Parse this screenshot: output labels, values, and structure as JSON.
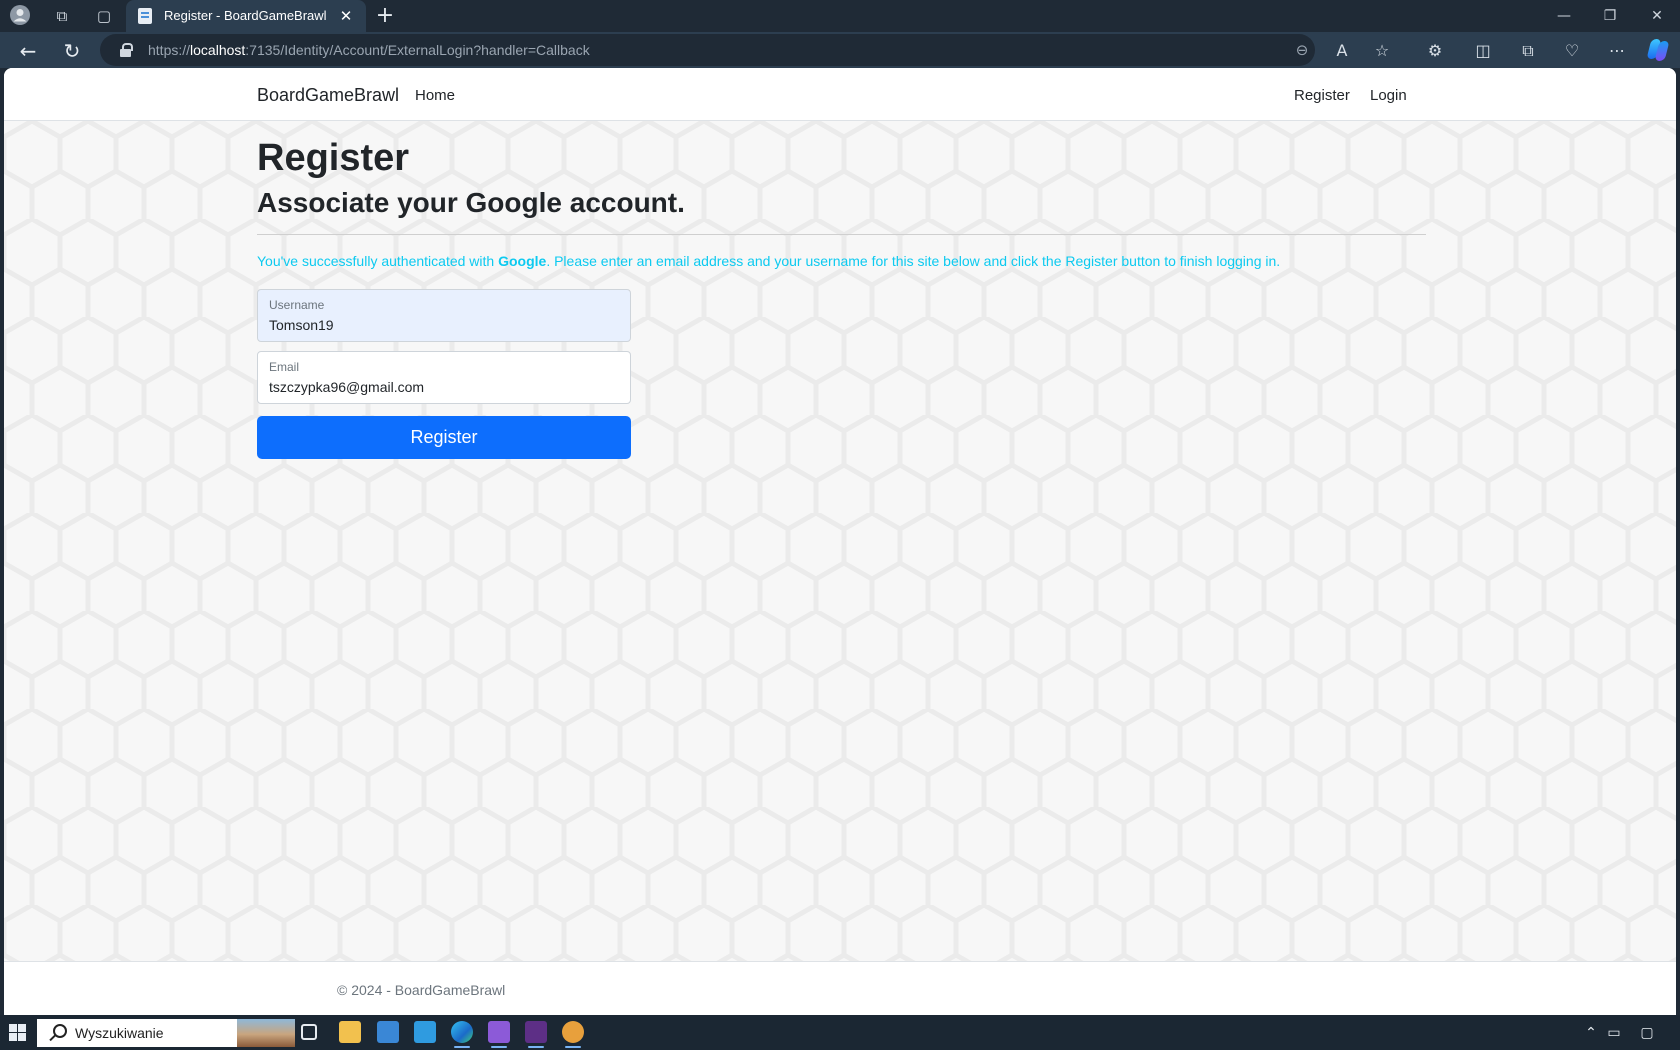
{
  "browser": {
    "tab_title": "Register - BoardGameBrawl",
    "url_prefix": "https://",
    "url_host": "localhost",
    "url_rest": ":7135/Identity/Account/ExternalLogin?handler=Callback"
  },
  "navbar": {
    "brand": "BoardGameBrawl",
    "home_link": "Home",
    "register_link": "Register",
    "login_link": "Login"
  },
  "main": {
    "heading": "Register",
    "subheading": "Associate your Google account.",
    "info_before": "You've successfully authenticated with ",
    "info_provider": "Google",
    "info_after": ". Please enter an email address and your username for this site below and click the Register button to finish logging in.",
    "username_label": "Username",
    "username_value": "Tomson19",
    "email_label": "Email",
    "email_value": "tszczypka96@gmail.com",
    "register_button": "Register"
  },
  "footer": {
    "text": "© 2024 - BoardGameBrawl"
  },
  "taskbar": {
    "search_placeholder": "Wyszukiwanie"
  },
  "colors": {
    "primary_button": "#0d6efd",
    "info_text": "#0dcaf0",
    "browser_chrome": "#2c3e50"
  }
}
